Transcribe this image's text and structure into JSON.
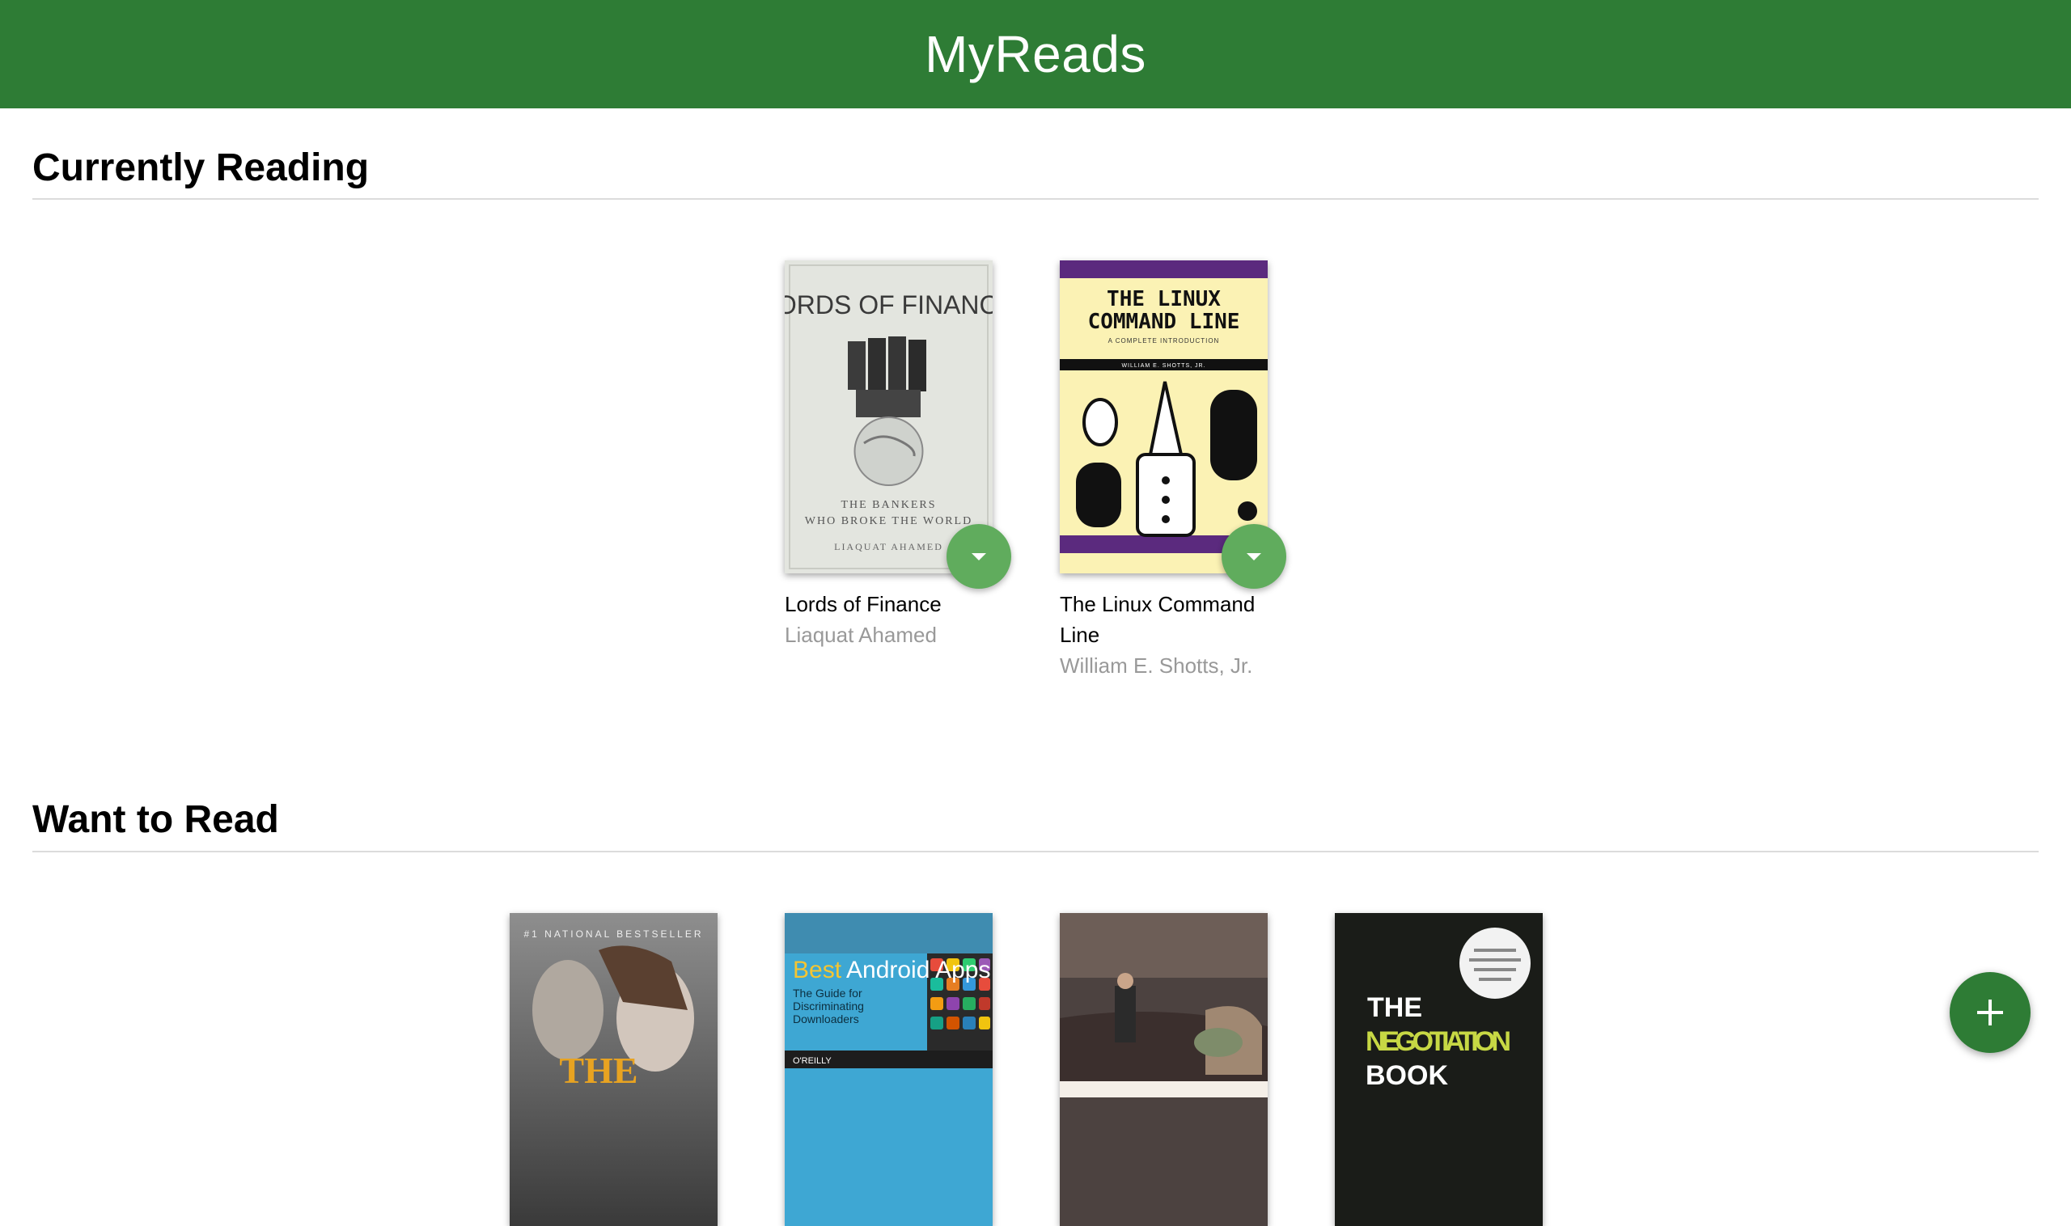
{
  "app": {
    "title": "MyReads"
  },
  "shelves": [
    {
      "title": "Currently Reading",
      "books": [
        {
          "title": "Lords of Finance",
          "author": "Liaquat Ahamed",
          "cover_text": [
            "LORDS OF FINANCE",
            "THE BANKERS",
            "WHO BROKE THE WORLD",
            "LIAQUAT AHAMED"
          ]
        },
        {
          "title": "The Linux Command Line",
          "author": "William E. Shotts, Jr.",
          "cover_text": [
            "THE LINUX",
            "COMMAND LINE",
            "A COMPLETE INTRODUCTION",
            "WILLIAM E. SHOTTS, JR."
          ]
        }
      ]
    },
    {
      "title": "Want to Read",
      "books": [
        {
          "cover_text": [
            "#1 NATIONAL BESTSELLER",
            "THE"
          ]
        },
        {
          "cover_text": [
            "Best",
            "Android Apps",
            "The Guide for",
            "Discriminating",
            "Downloaders",
            "O'REILLY"
          ]
        },
        {
          "cover_text": []
        },
        {
          "cover_text": [
            "THE",
            "NEGOTIATION",
            "BOOK"
          ]
        }
      ]
    }
  ],
  "colors": {
    "header": "#2e7c35",
    "shelf_changer": "#60ac5d",
    "add_button": "#2e7c35"
  },
  "icons": {
    "shelf_changer": "caret-down-icon",
    "add": "plus-icon"
  }
}
